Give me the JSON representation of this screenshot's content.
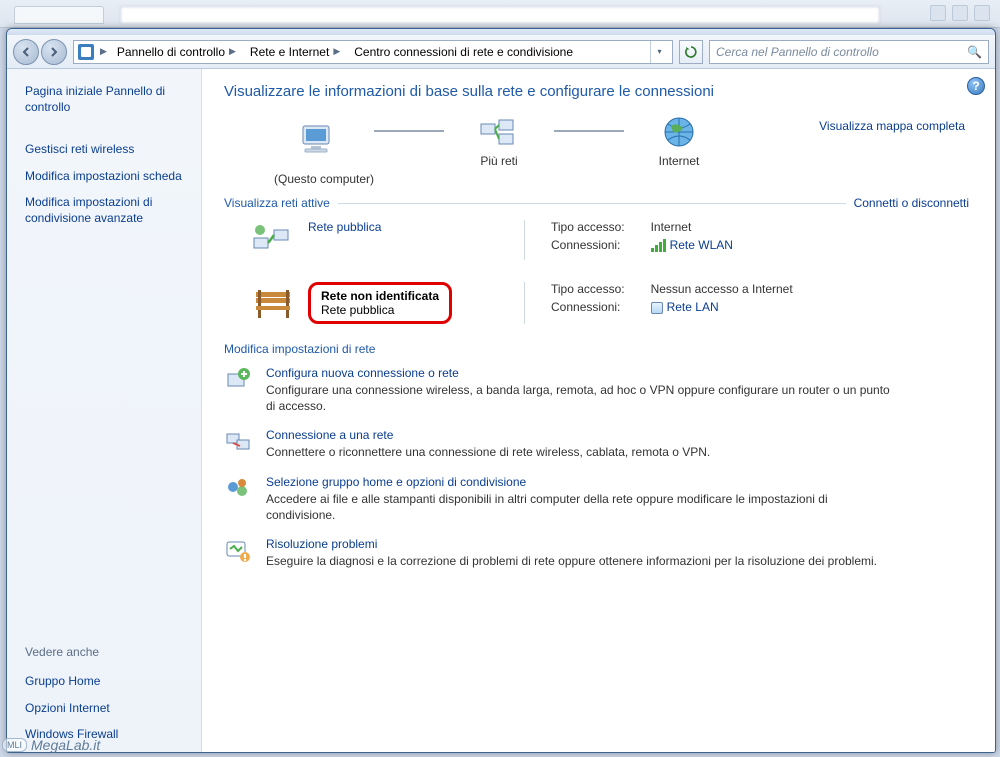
{
  "window": {
    "search_placeholder": "Cerca nel Pannello di controllo"
  },
  "breadcrumb": {
    "root_icon_name": "control-panel-icon",
    "items": [
      "Pannello di controllo",
      "Rete e Internet",
      "Centro connessioni di rete e condivisione"
    ]
  },
  "sidebar": {
    "home": "Pagina iniziale Pannello di controllo",
    "links": [
      "Gestisci reti wireless",
      "Modifica impostazioni scheda",
      "Modifica impostazioni di condivisione avanzate"
    ],
    "see_also_title": "Vedere anche",
    "see_also": [
      "Gruppo Home",
      "Opzioni Internet",
      "Windows Firewall"
    ]
  },
  "main": {
    "title": "Visualizzare le informazioni di base sulla rete e configurare le connessioni",
    "map_nodes": {
      "computer": "(Questo computer)",
      "middle": "Più reti",
      "internet": "Internet"
    },
    "view_full_map": "Visualizza mappa completa",
    "active_networks_label": "Visualizza reti attive",
    "connect_disconnect": "Connetti o disconnetti",
    "networks": [
      {
        "name": "Rete pubblica",
        "type": "",
        "highlight": false,
        "icon": "network-public",
        "access_label": "Tipo accesso:",
        "access_value": "Internet",
        "conn_label": "Connessioni:",
        "conn_value": "Rete WLAN",
        "conn_icon": "wifi"
      },
      {
        "name": "Rete non identificata",
        "type": "Rete pubblica",
        "highlight": true,
        "icon": "bench",
        "access_label": "Tipo accesso:",
        "access_value": "Nessun accesso a Internet",
        "conn_label": "Connessioni:",
        "conn_value": "Rete LAN",
        "conn_icon": "lan"
      }
    ],
    "modify_title": "Modifica impostazioni di rete",
    "options": [
      {
        "icon": "new-connection",
        "title": "Configura nuova connessione o rete",
        "desc": "Configurare una connessione wireless, a banda larga, remota, ad hoc o VPN oppure configurare un router o un punto di accesso."
      },
      {
        "icon": "connect-network",
        "title": "Connessione a una rete",
        "desc": "Connettere o riconnettere una connessione di rete wireless, cablata, remota o VPN."
      },
      {
        "icon": "homegroup",
        "title": "Selezione gruppo home e opzioni di condivisione",
        "desc": "Accedere ai file e alle stampanti disponibili in altri computer della rete oppure modificare le impostazioni di condivisione."
      },
      {
        "icon": "troubleshoot",
        "title": "Risoluzione problemi",
        "desc": "Eseguire la diagnosi e la correzione di problemi di rete oppure ottenere informazioni per la risoluzione dei problemi."
      }
    ]
  },
  "watermark": {
    "badge": "MLI",
    "text": "MegaLab.it"
  }
}
